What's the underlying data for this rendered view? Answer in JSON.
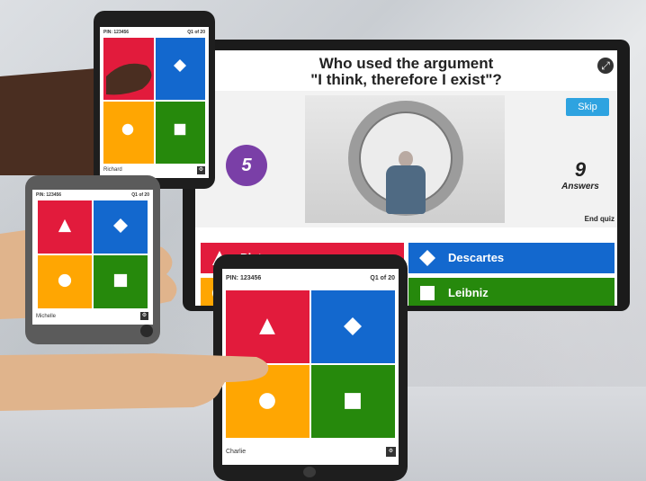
{
  "screen": {
    "question_line1": "Who used the argument",
    "question_line2": "\"I think, therefore I exist\"?",
    "timer": "5",
    "skip_label": "Skip",
    "answers_count": "9",
    "answers_label": "Answers",
    "end_quiz_label": "End quiz",
    "options": [
      {
        "label": "Plato",
        "shape": "triangle-icon",
        "color": "#e21b3c"
      },
      {
        "label": "Descartes",
        "shape": "diamond-icon",
        "color": "#1368ce"
      },
      {
        "label": "",
        "shape": "circle-icon",
        "color": "#ffa602"
      },
      {
        "label": "Leibniz",
        "shape": "square-icon",
        "color": "#26890c"
      }
    ]
  },
  "devices": [
    {
      "pin": "PIN: 123456",
      "progress": "Q1 of 20",
      "player": "Richard"
    },
    {
      "pin": "PIN: 123456",
      "progress": "Q1 of 20",
      "player": "Michelle"
    },
    {
      "pin": "PIN: 123456",
      "progress": "Q1 of 20",
      "player": "Charlie"
    }
  ],
  "colors": {
    "red": "#e21b3c",
    "blue": "#1368ce",
    "yellow": "#ffa602",
    "green": "#26890c",
    "timer": "#7a3fa7",
    "skip": "#2ea3e0"
  }
}
